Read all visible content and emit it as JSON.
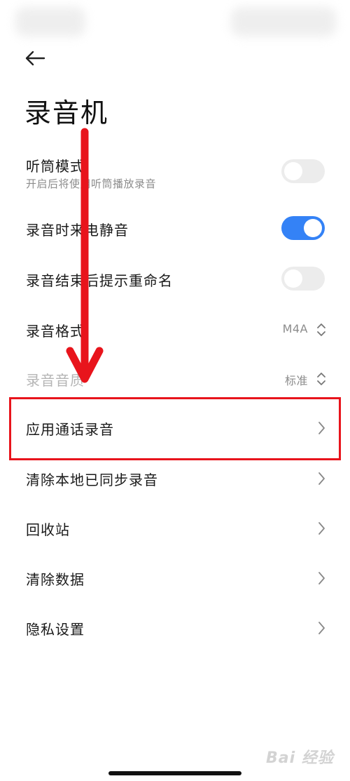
{
  "header": {
    "title": "录音机"
  },
  "settings": {
    "earpiece": {
      "label": "听筒模式",
      "sub": "开启后将使用听筒播放录音",
      "enabled": false
    },
    "mute_calls": {
      "label": "录音时来电静音",
      "enabled": true
    },
    "rename_prompt": {
      "label": "录音结束后提示重命名",
      "enabled": false
    },
    "format": {
      "label": "录音格式",
      "value": "M4A"
    },
    "quality": {
      "label": "录音音质",
      "value": "标准"
    },
    "call_recording": {
      "label": "应用通话录音"
    },
    "clear_synced": {
      "label": "清除本地已同步录音"
    },
    "recycle_bin": {
      "label": "回收站"
    },
    "clear_data": {
      "label": "清除数据"
    },
    "privacy": {
      "label": "隐私设置"
    }
  },
  "colors": {
    "toggle_on": "#3482f6",
    "toggle_off": "#ececec",
    "annotation_red": "#e8141c"
  },
  "watermark": "Bai  经验"
}
